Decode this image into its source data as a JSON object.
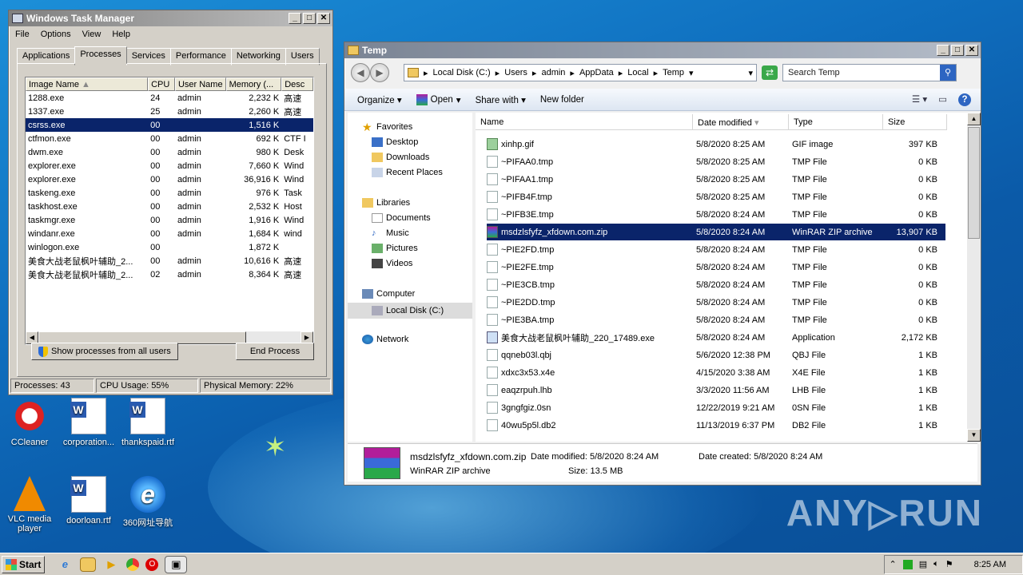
{
  "desktop": {
    "icons": [
      {
        "label": "CCleaner"
      },
      {
        "label": "corporation..."
      },
      {
        "label": "thankspaid.rtf"
      },
      {
        "label": "VLC media player"
      },
      {
        "label": "doorloan.rtf"
      },
      {
        "label": "360网址导航"
      }
    ],
    "watermark": "ANY▷RUN"
  },
  "taskmgr": {
    "title": "Windows Task Manager",
    "menu": [
      "File",
      "Options",
      "View",
      "Help"
    ],
    "tabs": [
      "Applications",
      "Processes",
      "Services",
      "Performance",
      "Networking",
      "Users"
    ],
    "columns": [
      "Image Name",
      "CPU",
      "User Name",
      "Memory (...",
      "Desc"
    ],
    "rows": [
      [
        "1288.exe",
        "24",
        "admin",
        "2,232 K",
        "高速"
      ],
      [
        "1337.exe",
        "25",
        "admin",
        "2,260 K",
        "高速"
      ],
      [
        "csrss.exe",
        "00",
        "",
        "1,516 K",
        ""
      ],
      [
        "ctfmon.exe",
        "00",
        "admin",
        "692 K",
        "CTF I"
      ],
      [
        "dwm.exe",
        "00",
        "admin",
        "980 K",
        "Desk"
      ],
      [
        "explorer.exe",
        "00",
        "admin",
        "7,660 K",
        "Wind"
      ],
      [
        "explorer.exe",
        "00",
        "admin",
        "36,916 K",
        "Wind"
      ],
      [
        "taskeng.exe",
        "00",
        "admin",
        "976 K",
        "Task"
      ],
      [
        "taskhost.exe",
        "00",
        "admin",
        "2,532 K",
        "Host"
      ],
      [
        "taskmgr.exe",
        "00",
        "admin",
        "1,916 K",
        "Wind"
      ],
      [
        "windanr.exe",
        "00",
        "admin",
        "1,684 K",
        "wind"
      ],
      [
        "winlogon.exe",
        "00",
        "",
        "1,872 K",
        ""
      ],
      [
        "美食大战老鼠枫叶辅助_2...",
        "00",
        "admin",
        "10,616 K",
        "高速"
      ],
      [
        "美食大战老鼠枫叶辅助_2...",
        "02",
        "admin",
        "8,364 K",
        "高速"
      ]
    ],
    "show_all_label": "Show processes from all users",
    "end_process_label": "End Process",
    "status": [
      "Processes: 43",
      "CPU Usage: 55%",
      "Physical Memory: 22%"
    ]
  },
  "explorer": {
    "title": "Temp",
    "path": [
      "Local Disk (C:)",
      "Users",
      "admin",
      "AppData",
      "Local",
      "Temp"
    ],
    "search_placeholder": "Search Temp",
    "commands": [
      "Organize",
      "Open",
      "Share with",
      "New folder"
    ],
    "nav": {
      "favorites": "Favorites",
      "fav_items": [
        "Desktop",
        "Downloads",
        "Recent Places"
      ],
      "libraries": "Libraries",
      "lib_items": [
        "Documents",
        "Music",
        "Pictures",
        "Videos"
      ],
      "computer": "Computer",
      "comp_items": [
        "Local Disk (C:)"
      ],
      "network": "Network"
    },
    "columns": [
      "Name",
      "Date modified",
      "Type",
      "Size"
    ],
    "files": [
      [
        "xinhp.gif",
        "5/8/2020 8:25 AM",
        "GIF image",
        "397 KB"
      ],
      [
        "~PIFAA0.tmp",
        "5/8/2020 8:25 AM",
        "TMP File",
        "0 KB"
      ],
      [
        "~PIFAA1.tmp",
        "5/8/2020 8:25 AM",
        "TMP File",
        "0 KB"
      ],
      [
        "~PIFB4F.tmp",
        "5/8/2020 8:25 AM",
        "TMP File",
        "0 KB"
      ],
      [
        "~PIFB3E.tmp",
        "5/8/2020 8:24 AM",
        "TMP File",
        "0 KB"
      ],
      [
        "msdzlsfyfz_xfdown.com.zip",
        "5/8/2020 8:24 AM",
        "WinRAR ZIP archive",
        "13,907 KB"
      ],
      [
        "~PIE2FD.tmp",
        "5/8/2020 8:24 AM",
        "TMP File",
        "0 KB"
      ],
      [
        "~PIE2FE.tmp",
        "5/8/2020 8:24 AM",
        "TMP File",
        "0 KB"
      ],
      [
        "~PIE3CB.tmp",
        "5/8/2020 8:24 AM",
        "TMP File",
        "0 KB"
      ],
      [
        "~PIE2DD.tmp",
        "5/8/2020 8:24 AM",
        "TMP File",
        "0 KB"
      ],
      [
        "~PIE3BA.tmp",
        "5/8/2020 8:24 AM",
        "TMP File",
        "0 KB"
      ],
      [
        "美食大战老鼠枫叶辅助_220_17489.exe",
        "5/8/2020 8:24 AM",
        "Application",
        "2,172 KB"
      ],
      [
        "qqneb03l.qbj",
        "5/6/2020 12:38 PM",
        "QBJ File",
        "1 KB"
      ],
      [
        "xdxc3x53.x4e",
        "4/15/2020 3:38 AM",
        "X4E File",
        "1 KB"
      ],
      [
        "eaqzrpuh.lhb",
        "3/3/2020 11:56 AM",
        "LHB File",
        "1 KB"
      ],
      [
        "3gngfgiz.0sn",
        "12/22/2019 9:21 AM",
        "0SN File",
        "1 KB"
      ],
      [
        "40wu5p5l.db2",
        "11/13/2019 6:37 PM",
        "DB2 File",
        "1 KB"
      ]
    ],
    "details": {
      "name": "msdzlsfyfz_xfdown.com.zip",
      "modified": "Date modified: 5/8/2020 8:24 AM",
      "created": "Date created: 5/8/2020 8:24 AM",
      "type": "WinRAR ZIP archive",
      "size": "Size: 13.5 MB"
    }
  },
  "taskbar": {
    "start": "Start",
    "clock": "8:25 AM"
  }
}
